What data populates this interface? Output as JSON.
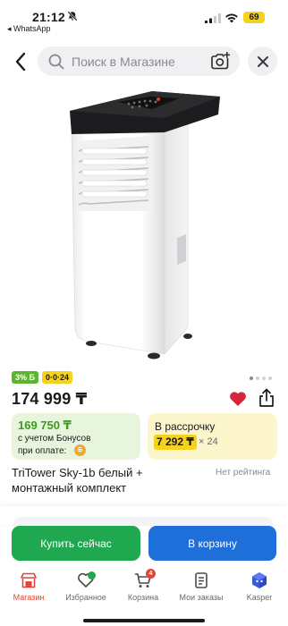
{
  "status_bar": {
    "time": "21:12",
    "back_app": "◂ WhatsApp",
    "battery": "69"
  },
  "header": {
    "search_placeholder": "Поиск в Магазине"
  },
  "product": {
    "badges": {
      "bonus": "3% Б",
      "installment": "0·0·24"
    },
    "price": "174 999 ₸",
    "bonus_card": {
      "amount": "169 750 ₸",
      "desc_line1": "с учетом Бонусов",
      "desc_line2": "при оплате:",
      "coin": "Б"
    },
    "installment_card": {
      "label": "В рассрочку",
      "amount": "7 292 ₸",
      "times": "× 24"
    },
    "title": "TriTower Sky-1b белый + монтажный комплект",
    "rating": "Нет рейтинга"
  },
  "actions": {
    "buy_now": "Купить сейчас",
    "add_to_cart": "В корзину"
  },
  "tabs": [
    {
      "label": "Магазин"
    },
    {
      "label": "Избранное"
    },
    {
      "label": "Корзина",
      "badge": "4"
    },
    {
      "label": "Мои заказы"
    },
    {
      "label": "Kasper"
    }
  ],
  "colors": {
    "accent_red": "#e0463a",
    "buy_green": "#1fa84f",
    "cart_blue": "#1e6fd9",
    "installment_yellow": "#f5d21c"
  }
}
